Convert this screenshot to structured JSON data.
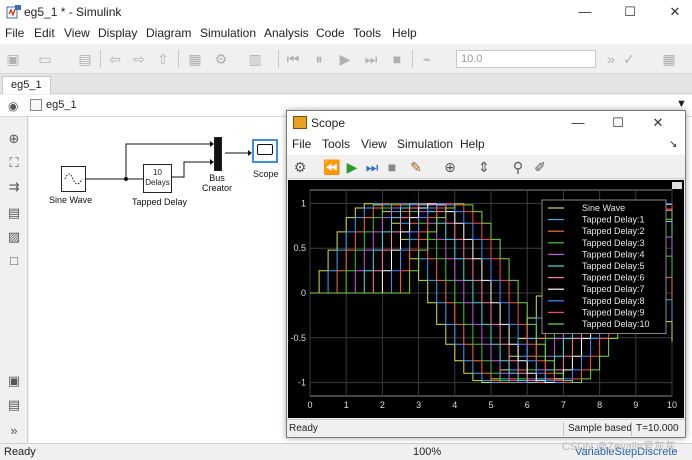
{
  "window": {
    "title": "eg5_1 * - Simulink",
    "controls": {
      "minimize": "—",
      "maximize": "☐",
      "close": "✕"
    }
  },
  "menu": [
    "File",
    "Edit",
    "View",
    "Display",
    "Diagram",
    "Simulation",
    "Analysis",
    "Code",
    "Tools",
    "Help"
  ],
  "toolbar": {
    "stop_time": "10.0"
  },
  "tabs": [
    "eg5_1"
  ],
  "breadcrumb": "eg5_1",
  "blocks": {
    "sine": "Sine Wave",
    "delay_body": "10\nDelays",
    "delay": "Tapped Delay",
    "bus": "Bus\nCreator",
    "scope": "Scope"
  },
  "status": {
    "left": "Ready",
    "zoom": "100%",
    "solver": "VariableStepDiscrete"
  },
  "watermark": "CSDN @Zevalin爱灰灰",
  "scope": {
    "title": "Scope",
    "menu": [
      "File",
      "Tools",
      "View",
      "Simulation",
      "Help"
    ],
    "status_left": "Ready",
    "sample": "Sample based",
    "time": "T=10.000"
  },
  "colors": {
    "accent": "#1f6fbf",
    "plot_bg": "#000000",
    "grid": "#3c3c3c"
  },
  "chart_data": {
    "type": "line",
    "title": "",
    "xlabel": "",
    "ylabel": "",
    "xlim": [
      0,
      10
    ],
    "ylim": [
      -1.15,
      1.15
    ],
    "xticks": [
      0,
      1,
      2,
      3,
      4,
      5,
      6,
      7,
      8,
      9,
      10
    ],
    "yticks": [
      1,
      0.5,
      0,
      -0.5,
      -1
    ],
    "grid": true,
    "legend_position": "top-right",
    "sample_time": 0.25,
    "signal": "sin(t)",
    "series": [
      {
        "name": "Sine Wave",
        "delay": 0,
        "color": "#d8e23c"
      },
      {
        "name": "Tapped Delay:1",
        "delay": 1,
        "color": "#36a6ff"
      },
      {
        "name": "Tapped Delay:2",
        "delay": 2,
        "color": "#ff6a3d"
      },
      {
        "name": "Tapped Delay:3",
        "delay": 3,
        "color": "#3cc93c"
      },
      {
        "name": "Tapped Delay:4",
        "delay": 4,
        "color": "#c85ae6"
      },
      {
        "name": "Tapped Delay:5",
        "delay": 5,
        "color": "#3fe0e0"
      },
      {
        "name": "Tapped Delay:6",
        "delay": 6,
        "color": "#ff7aa8"
      },
      {
        "name": "Tapped Delay:7",
        "delay": 7,
        "color": "#ffffff"
      },
      {
        "name": "Tapped Delay:8",
        "delay": 8,
        "color": "#3f8cff"
      },
      {
        "name": "Tapped Delay:9",
        "delay": 9,
        "color": "#ff4a4a"
      },
      {
        "name": "Tapped Delay:10",
        "delay": 10,
        "color": "#7ad63f"
      }
    ]
  }
}
